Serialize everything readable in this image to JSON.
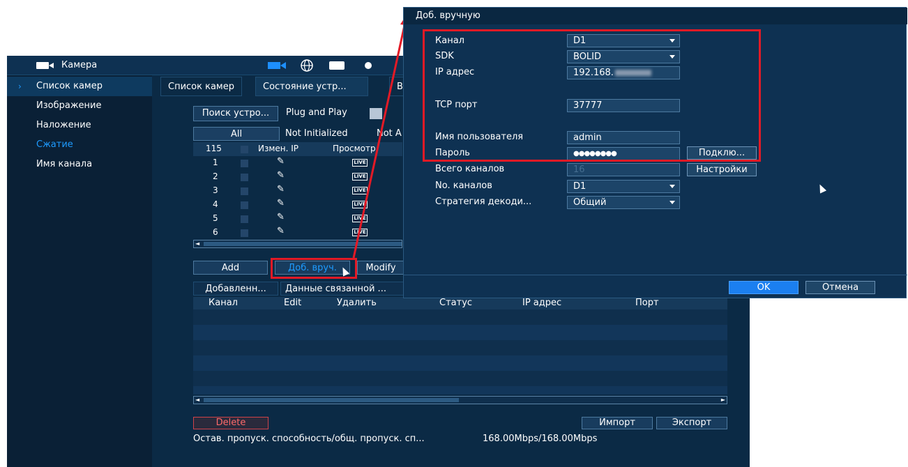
{
  "sidebar": {
    "title": "Камера",
    "items": [
      {
        "label": "Список камер",
        "active": true
      },
      {
        "label": "Изображение"
      },
      {
        "label": "Наложение"
      },
      {
        "label": "Сжатие",
        "highlight": true
      },
      {
        "label": "Имя канала"
      }
    ]
  },
  "tabs": [
    {
      "label": "Список камер"
    },
    {
      "label": "Состояние устр..."
    },
    {
      "label": "В"
    }
  ],
  "toolbar": {
    "search_button": "Поиск устро...",
    "plug_and_play": "Plug and Play"
  },
  "filters": {
    "all": "All",
    "not_initialized": "Not Initialized",
    "not_a": "Not A"
  },
  "device_grid": {
    "count": "115",
    "col_change_ip": "Измен. IP",
    "col_view": "Просмотр",
    "rows": [
      "1",
      "2",
      "3",
      "4",
      "5",
      "6"
    ],
    "live_label": "LIVE"
  },
  "actions": {
    "add": "Add",
    "manual_add": "Доб. вруч.",
    "modify": "Modify"
  },
  "added_tabs": {
    "added": "Добавленн...",
    "linked": "Данные связанной ..."
  },
  "added_columns": [
    "Канал",
    "Edit",
    "Удалить",
    "Статус",
    "IP адрес",
    "Порт"
  ],
  "footer": {
    "delete": "Delete",
    "import": "Импорт",
    "export": "Экспорт",
    "bandwidth_label": "Остав. пропуск. способность/общ. пропуск. сп...",
    "bandwidth_value": "168.00Mbps/168.00Mbps"
  },
  "dialog": {
    "title": "Доб. вручную",
    "fields": {
      "channel_label": "Канал",
      "channel_value": "D1",
      "sdk_label": "SDK",
      "sdk_value": "BOLID",
      "ip_label": "IP адрес",
      "ip_value": "192.168.",
      "tcp_label": "TCP порт",
      "tcp_value": "37777",
      "user_label": "Имя пользователя",
      "user_value": "admin",
      "pass_label": "Пароль",
      "pass_value": "●●●●●●●●",
      "total_label": "Всего каналов",
      "total_value": "16",
      "no_label": "No. каналов",
      "no_value": "D1",
      "strategy_label": "Стратегия декоди...",
      "strategy_value": "Общий"
    },
    "connect_button": "Подклю...",
    "settings_button": "Настройки",
    "ok": "OK",
    "cancel": "Отмена"
  },
  "colors": {
    "accent": "#1b7ff0",
    "highlight_box": "#e21a26",
    "background": "#0b2a45"
  }
}
